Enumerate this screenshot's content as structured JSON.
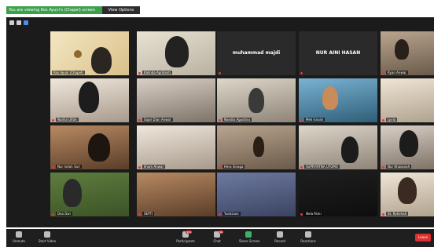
{
  "top_banner": {
    "share_text": "You are viewing Ros Ayuni's (Chapel) screen",
    "view_options_label": "View Options"
  },
  "participants": [
    {
      "name": "Ros Ayuni (Chapel)",
      "center_label": ""
    },
    {
      "name": "Kalinda Aprilianti",
      "center_label": ""
    },
    {
      "name": "",
      "center_label": "muhammad majdi"
    },
    {
      "name": "",
      "center_label": "NUR AINI HASAN"
    },
    {
      "name": "Ryan Anwar",
      "center_label": ""
    },
    {
      "name": "Nurilia Ulfah",
      "center_label": ""
    },
    {
      "name": "Sapri Dian Anwar",
      "center_label": ""
    },
    {
      "name": "Nandia Agustina",
      "center_label": ""
    },
    {
      "name": "Meli Isnaini",
      "center_label": ""
    },
    {
      "name": "Lyvia",
      "center_label": ""
    },
    {
      "name": "Nur Indah Sari",
      "center_label": ""
    },
    {
      "name": "Ilham Anwar",
      "center_label": ""
    },
    {
      "name": "Hera Sinaga",
      "center_label": ""
    },
    {
      "name": "SUPRIYATNA UTOMO",
      "center_label": ""
    },
    {
      "name": "Nur Khasanah",
      "center_label": ""
    },
    {
      "name": "Dea Dwi",
      "center_label": ""
    },
    {
      "name": "SEPTI",
      "center_label": ""
    },
    {
      "name": "Yustisiani",
      "center_label": ""
    },
    {
      "name": "Nela Riski",
      "center_label": ""
    },
    {
      "name": "St. Rohimah",
      "center_label": ""
    }
  ],
  "toolbar": {
    "mute_label": "Unmute",
    "video_label": "Start Video",
    "participants_label": "Participants",
    "participants_count": "121",
    "chat_label": "Chat",
    "chat_badge": "99",
    "share_label": "Share Screen",
    "record_label": "Record",
    "reactions_label": "Reactions",
    "leave_label": "Leave"
  },
  "colors": {
    "window_bg": "#1b1b1b",
    "toolbar_bg": "#1f1f1f",
    "share_banner": "#3aa04a",
    "leave_button": "#e02f2f",
    "mute_dot": "#e03a3a"
  }
}
